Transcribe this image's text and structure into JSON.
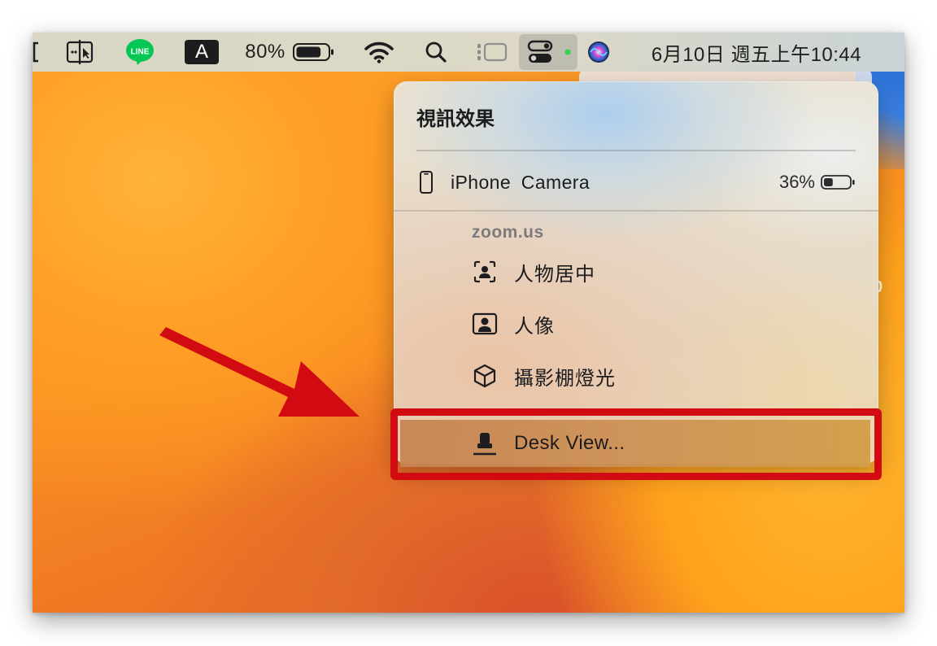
{
  "menubar": {
    "line_label": "LINE",
    "input_label": "A",
    "battery_pct": "80%",
    "battery_level": 0.8,
    "datetime": "6月10日 週五上午10:44",
    "icons": [
      "split-screen-icon",
      "line-app-icon",
      "input-source-icon",
      "battery-icon",
      "wifi-icon",
      "spotlight-search-icon",
      "stage-manager-icon",
      "control-center-icon",
      "siri-icon"
    ]
  },
  "popover": {
    "title": "視訊效果",
    "device": {
      "name": "iPhone  Camera",
      "battery_pct": "36%",
      "battery_level": 0.36
    },
    "section": "zoom.us",
    "effects": [
      {
        "label": "人物居中",
        "icon": "center-stage-icon"
      },
      {
        "label": "人像",
        "icon": "portrait-icon"
      },
      {
        "label": "攝影棚燈光",
        "icon": "studio-light-icon"
      }
    ],
    "desk_view": "Desk View..."
  },
  "background": {
    "edge_text": "0"
  },
  "colors": {
    "annotation": "#d20b12",
    "green_dot": "#32d74b",
    "line_green": "#06c755"
  }
}
